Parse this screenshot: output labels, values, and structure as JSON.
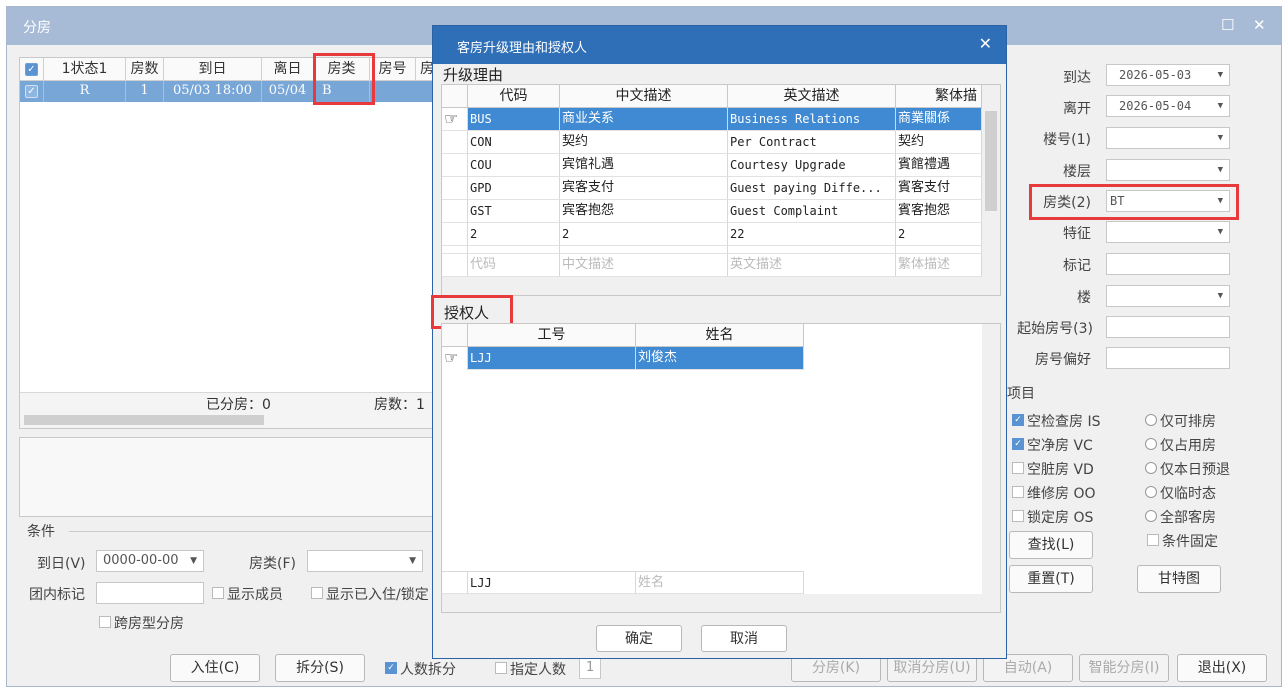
{
  "window": {
    "title": "分房",
    "minimize_glyph": "☐",
    "close_glyph": "✕"
  },
  "left_grid": {
    "headers": [
      "1状态1",
      "房数",
      "到日",
      "离日",
      "房类",
      "房号",
      "房"
    ],
    "row": {
      "status": "R",
      "rooms": "1",
      "arrive": "05/03 18:00",
      "depart": "05/04",
      "room_type": "B"
    },
    "footer_assigned": "已分房：0",
    "footer_rooms": "房数：1"
  },
  "conditions": {
    "title": "条件",
    "arrive_label": "到日(V)",
    "arrive_value": "0000-00-00",
    "room_type_label": "房类(F)",
    "group_mark_label": "团内标记",
    "show_members": "显示成员",
    "show_checked": "显示已入住/锁定",
    "cross_room_type": "跨房型分房"
  },
  "bottom_bar": {
    "checkin": "入住(C)",
    "split": "拆分(S)",
    "split_by_people": "人数拆分",
    "specify_people": "指定人数",
    "people_count": "1",
    "assign": "分房(K)",
    "cancel_assign": "取消分房(U)",
    "auto": "自动(A)",
    "smart_assign": "智能分房(I)",
    "exit": "退出(X)"
  },
  "dialog": {
    "title": "客房升级理由和授权人",
    "close_glyph": "✕",
    "reason_group": "升级理由",
    "reason_headers": [
      "代码",
      "中文描述",
      "英文描述",
      "繁体描"
    ],
    "reasons": [
      {
        "code": "BUS",
        "cn": "商业关系",
        "en": "Business Relations",
        "tw": "商業關係"
      },
      {
        "code": "CON",
        "cn": "契约",
        "en": "Per Contract",
        "tw": "契约"
      },
      {
        "code": "COU",
        "cn": "宾馆礼遇",
        "en": "Courtesy Upgrade",
        "tw": "賓館禮遇"
      },
      {
        "code": "GPD",
        "cn": "宾客支付",
        "en": "Guest paying Diffe...",
        "tw": "賓客支付"
      },
      {
        "code": "GST",
        "cn": "宾客抱怨",
        "en": "Guest Complaint",
        "tw": "賓客抱怨"
      },
      {
        "code": "2",
        "cn": "2",
        "en": "22",
        "tw": "2"
      }
    ],
    "reason_filter_placeholders": [
      "代码",
      "中文描述",
      "英文描述",
      "繁体描述"
    ],
    "auth_group": "授权人",
    "auth_headers": [
      "工号",
      "姓名"
    ],
    "auth_rows": [
      {
        "id": "LJJ",
        "name": "刘俊杰"
      }
    ],
    "auth_filter_id": "LJJ",
    "auth_filter_name_placeholder": "姓名",
    "ok": "确定",
    "cancel": "取消"
  },
  "right_panel": {
    "arrive_label": "到达",
    "arrive_value": "2026-05-03",
    "depart_label": "离开",
    "depart_value": "2026-05-04",
    "building_label": "楼号(1)",
    "floor_label": "楼层",
    "room_type_label": "房类(2)",
    "room_type_value": "BT",
    "feature_label": "特征",
    "mark_label": "标记",
    "tower_label": "楼",
    "start_room_label": "起始房号(3)",
    "room_pref_label": "房号偏好",
    "options_title": "项目",
    "status_options": [
      {
        "label": "空检查房 IS",
        "checked": true
      },
      {
        "label": "空净房 VC",
        "checked": true
      },
      {
        "label": "空脏房 VD",
        "checked": false
      },
      {
        "label": "维修房 OO",
        "checked": false
      },
      {
        "label": "锁定房 OS",
        "checked": false
      }
    ],
    "radio_options": [
      "仅可排房",
      "仅占用房",
      "仅本日预退",
      "仅临时态",
      "全部客房"
    ],
    "fixed_condition": "条件固定",
    "search": "查找(L)",
    "reset": "重置(T)",
    "gantt": "甘特图"
  }
}
